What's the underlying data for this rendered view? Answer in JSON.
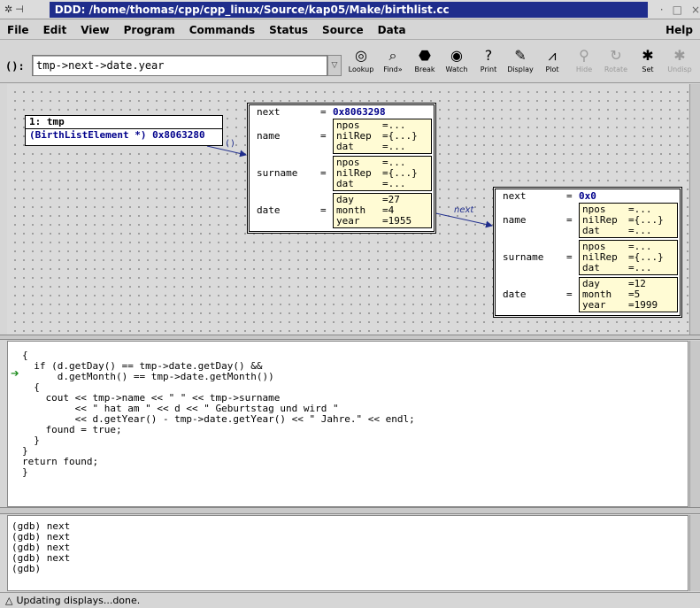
{
  "window": {
    "title": "DDD: /home/thomas/cpp/cpp_linux/Source/kap05/Make/birthlist.cc",
    "icons": [
      "ddd-logo-icon",
      "pin-icon"
    ],
    "controls": [
      "·",
      "□",
      "×"
    ]
  },
  "menubar": {
    "items": [
      "File",
      "Edit",
      "View",
      "Program",
      "Commands",
      "Status",
      "Source",
      "Data"
    ],
    "help": "Help"
  },
  "toolbar": {
    "arg_label": "():",
    "arg_value": "tmp->next->date.year",
    "buttons": [
      {
        "label": "Lookup",
        "icon": "lookup-icon",
        "glyph": "◎",
        "enabled": true
      },
      {
        "label": "Find»",
        "icon": "find-icon",
        "glyph": "⌕",
        "enabled": true
      },
      {
        "label": "Break",
        "icon": "break-icon",
        "glyph": "⬣",
        "enabled": true
      },
      {
        "label": "Watch",
        "icon": "watch-icon",
        "glyph": "◉",
        "enabled": true
      },
      {
        "label": "Print",
        "icon": "print-icon",
        "glyph": "?",
        "enabled": true
      },
      {
        "label": "Display",
        "icon": "display-icon",
        "glyph": "✎",
        "enabled": true
      },
      {
        "label": "Plot",
        "icon": "plot-icon",
        "glyph": "⩘",
        "enabled": true
      },
      {
        "label": "Hide",
        "icon": "hide-icon",
        "glyph": "⚲",
        "enabled": false
      },
      {
        "label": "Rotate",
        "icon": "rotate-icon",
        "glyph": "↻",
        "enabled": false
      },
      {
        "label": "Set",
        "icon": "set-icon",
        "glyph": "✱",
        "enabled": true
      },
      {
        "label": "Undisp",
        "icon": "undisp-icon",
        "glyph": "✱",
        "enabled": false
      }
    ]
  },
  "data_displays": {
    "tmp": {
      "header": "1: tmp",
      "value": "(BirthListElement *) 0x8063280"
    },
    "struct1": {
      "next_label": "next",
      "next_value": "0x8063298",
      "name_label": "name",
      "name_fields": [
        [
          "npos",
          "..."
        ],
        [
          "nilRep",
          "{...}"
        ],
        [
          "dat",
          "..."
        ]
      ],
      "surname_label": "surname",
      "surname_fields": [
        [
          "npos",
          "..."
        ],
        [
          "nilRep",
          "{...}"
        ],
        [
          "dat",
          "..."
        ]
      ],
      "date_label": "date",
      "date_fields": [
        [
          "day",
          "27"
        ],
        [
          "month",
          "4"
        ],
        [
          "year",
          "1955"
        ]
      ]
    },
    "struct2": {
      "next_label": "next",
      "next_value": "0x0",
      "name_label": "name",
      "name_fields": [
        [
          "npos",
          "..."
        ],
        [
          "nilRep",
          "{...}"
        ],
        [
          "dat",
          "..."
        ]
      ],
      "surname_label": "surname",
      "surname_fields": [
        [
          "npos",
          "..."
        ],
        [
          "nilRep",
          "{...}"
        ],
        [
          "dat",
          "..."
        ]
      ],
      "date_label": "date",
      "date_fields": [
        [
          "day",
          "12"
        ],
        [
          "month",
          "5"
        ],
        [
          "year",
          "1999"
        ]
      ]
    },
    "arrow_label_tmp": "()",
    "arrow_label_next": "next"
  },
  "source": {
    "lines": [
      "{",
      "  if (d.getDay() == tmp->date.getDay() &&",
      "      d.getMonth() == tmp->date.getMonth())",
      "  {",
      "    cout << tmp->name << \" \" << tmp->surname",
      "         << \" hat am \" << d << \" Geburtstag und wird \"",
      "         << d.getYear() - tmp->date.getYear() << \" Jahre.\" << endl;",
      "    found = true;",
      "  }",
      "}",
      "",
      "return found;",
      "}"
    ]
  },
  "console": {
    "lines": [
      "(gdb) next",
      "(gdb) next",
      "(gdb) next",
      "(gdb) next",
      "(gdb) "
    ]
  },
  "status": {
    "icon": "△",
    "text": "Updating displays...done."
  }
}
